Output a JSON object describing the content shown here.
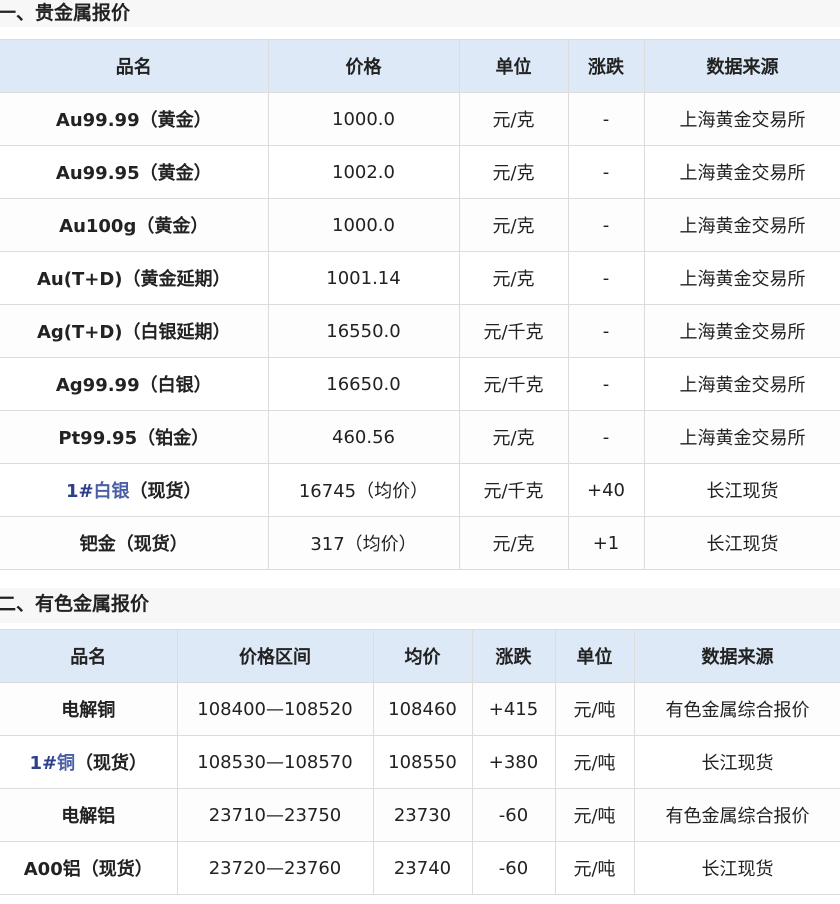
{
  "sections": [
    {
      "title": "一、贵金属报价",
      "headers": [
        "品名",
        "价格",
        "单位",
        "涨跌",
        "数据来源"
      ],
      "rows": [
        {
          "name": "Au99.99（黄金）",
          "price": "1000.0",
          "unit": "元/克",
          "change": "-",
          "source": "上海黄金交易所"
        },
        {
          "name": "Au99.95（黄金）",
          "price": "1002.0",
          "unit": "元/克",
          "change": "-",
          "source": "上海黄金交易所"
        },
        {
          "name": "Au100g（黄金）",
          "price": "1000.0",
          "unit": "元/克",
          "change": "-",
          "source": "上海黄金交易所"
        },
        {
          "name": "Au(T+D)（黄金延期）",
          "price": "1001.14",
          "unit": "元/克",
          "change": "-",
          "source": "上海黄金交易所"
        },
        {
          "name": "Ag(T+D)（白银延期）",
          "price": "16550.0",
          "unit": "元/千克",
          "change": "-",
          "source": "上海黄金交易所"
        },
        {
          "name": "Ag99.99（白银）",
          "price": "16650.0",
          "unit": "元/千克",
          "change": "-",
          "source": "上海黄金交易所"
        },
        {
          "name": "Pt99.95（铂金）",
          "price": "460.56",
          "unit": "元/克",
          "change": "-",
          "source": "上海黄金交易所"
        },
        {
          "name_prefix": "1#",
          "name_link": "白银",
          "name_suffix": "（现货）",
          "price": "16745（均价）",
          "unit": "元/千克",
          "change": "+40",
          "source": "长江现货"
        },
        {
          "name": "钯金（现货）",
          "price": "317（均价）",
          "unit": "元/克",
          "change": "+1",
          "source": "长江现货"
        }
      ]
    },
    {
      "title": "二、有色金属报价",
      "headers": [
        "品名",
        "价格区间",
        "均价",
        "涨跌",
        "单位",
        "数据来源"
      ],
      "rows": [
        {
          "name": "电解铜",
          "range": "108400—108520",
          "avg": "108460",
          "change": "+415",
          "unit": "元/吨",
          "source": "有色金属综合报价"
        },
        {
          "name_prefix": "1#",
          "name_link": "铜",
          "name_suffix": "（现货）",
          "range": "108530—108570",
          "avg": "108550",
          "change": "+380",
          "unit": "元/吨",
          "source": "长江现货"
        },
        {
          "name": "电解铝",
          "range": "23710—23750",
          "avg": "23730",
          "change": "-60",
          "unit": "元/吨",
          "source": "有色金属综合报价"
        },
        {
          "name": "A00铝（现货）",
          "range": "23720—23760",
          "avg": "23740",
          "change": "-60",
          "unit": "元/吨",
          "source": "长江现货"
        }
      ]
    }
  ]
}
